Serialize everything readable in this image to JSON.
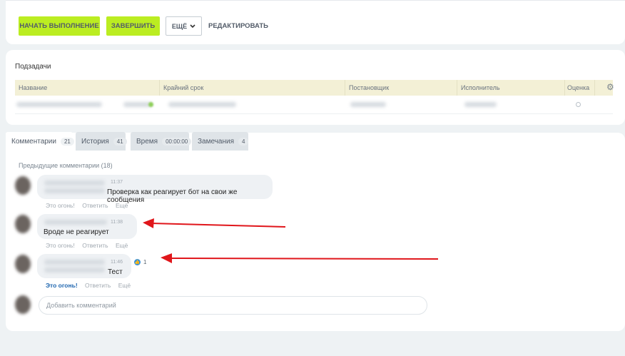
{
  "toolbar": {
    "start_label": "НАЧАТЬ ВЫПОЛНЕНИЕ",
    "finish_label": "ЗАВЕРШИТЬ",
    "more_label": "ЕЩЁ",
    "edit_label": "РЕДАКТИРОВАТЬ"
  },
  "subtasks": {
    "title": "Подзадачи",
    "columns": [
      "Название",
      "Крайний срок",
      "Постановщик",
      "Исполнитель",
      "Оценка"
    ]
  },
  "tabs": [
    {
      "label": "Комментарии",
      "count": "21"
    },
    {
      "label": "История",
      "count": "41"
    },
    {
      "label": "Время",
      "count": "00:00:00"
    },
    {
      "label": "Замечания",
      "count": "4"
    }
  ],
  "comments_section": {
    "previous_label": "Предыдущие комментарии (18)",
    "comments": [
      {
        "time": "11:37",
        "text": "Проверка как реагирует бот на свои же сообщения"
      },
      {
        "time": "11:38",
        "text": "Вроде не реагирует"
      },
      {
        "time": "11:46",
        "text": "Тест",
        "likes": "1"
      }
    ],
    "actions": {
      "like": "Это огонь!",
      "reply": "Ответить",
      "more": "Ещё"
    },
    "input_placeholder": "Добавить комментарий"
  },
  "colors": {
    "accent_green": "#bbed21",
    "annotation_red": "#e0161b"
  }
}
